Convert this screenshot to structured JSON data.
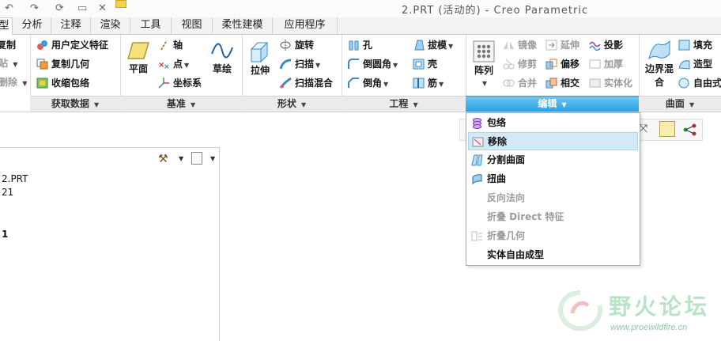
{
  "window": {
    "title": "2.PRT (活动的) - Creo Parametric"
  },
  "tabs": [
    {
      "label": "型",
      "active": true
    },
    {
      "label": "分析"
    },
    {
      "label": "注释"
    },
    {
      "label": "渲染"
    },
    {
      "label": "工具"
    },
    {
      "label": "视图"
    },
    {
      "label": "柔性建模"
    },
    {
      "label": "应用程序"
    }
  ],
  "ribbon": {
    "clipboard": {
      "copy": "复制",
      "paste": "贴",
      "delete": "删除"
    },
    "get_data": {
      "label": "获取数据",
      "items": [
        "用户定义特征",
        "复制几何",
        "收缩包络"
      ]
    },
    "datum": {
      "label": "基准",
      "plane": "平面",
      "axis": "轴",
      "point": "点",
      "csys": "坐标系",
      "sketch": "草绘"
    },
    "shapes": {
      "label": "形状",
      "extrude": "拉伸",
      "revolve": "旋转",
      "sweep": "扫描",
      "swept_blend": "扫描混合"
    },
    "engineering": {
      "label": "工程",
      "hole": "孔",
      "round": "倒圆角",
      "chamfer": "倒角",
      "draft": "拔模",
      "shell": "壳",
      "rib": "筋"
    },
    "editing": {
      "label": "编辑",
      "pattern": "阵列",
      "mirror": "镜像",
      "trim": "修剪",
      "merge": "合并",
      "extend": "延伸",
      "offset": "偏移",
      "intersect": "相交",
      "project": "投影",
      "thicken": "加厚",
      "solidify": "实体化"
    },
    "surfaces": {
      "label": "曲面",
      "boundary_blend": "边界混合",
      "fill": "填充",
      "style": "造型",
      "freestyle": "自由式"
    }
  },
  "model_tree": {
    "lines": [
      "2.PRT",
      "21",
      "1"
    ]
  },
  "edit_menu": {
    "items": [
      {
        "label": "包络",
        "icon": "wrap-icon",
        "disabled": false,
        "highlighted": false
      },
      {
        "label": "移除",
        "icon": "remove-icon",
        "disabled": false,
        "highlighted": true
      },
      {
        "label": "分割曲面",
        "icon": "split-surface-icon",
        "disabled": false,
        "highlighted": false
      },
      {
        "label": "扭曲",
        "icon": "warp-icon",
        "disabled": false,
        "highlighted": false
      },
      {
        "label": "反向法向",
        "icon": "",
        "disabled": true,
        "highlighted": false
      },
      {
        "label": "折叠 Direct 特征",
        "icon": "",
        "disabled": true,
        "highlighted": false
      },
      {
        "label": "折叠几何",
        "icon": "collapse-geometry-icon",
        "disabled": true,
        "highlighted": false
      },
      {
        "label": "实体自由成型",
        "icon": "",
        "disabled": false,
        "highlighted": false
      }
    ]
  },
  "watermark": {
    "title": "野火论坛",
    "url": "www.proewildfire.cn"
  },
  "colors": {
    "accent": "#2b9fe2",
    "highlight": "#d3e9f7",
    "disabled": "#9c9c9c",
    "watermark": "#b9e3c6"
  }
}
